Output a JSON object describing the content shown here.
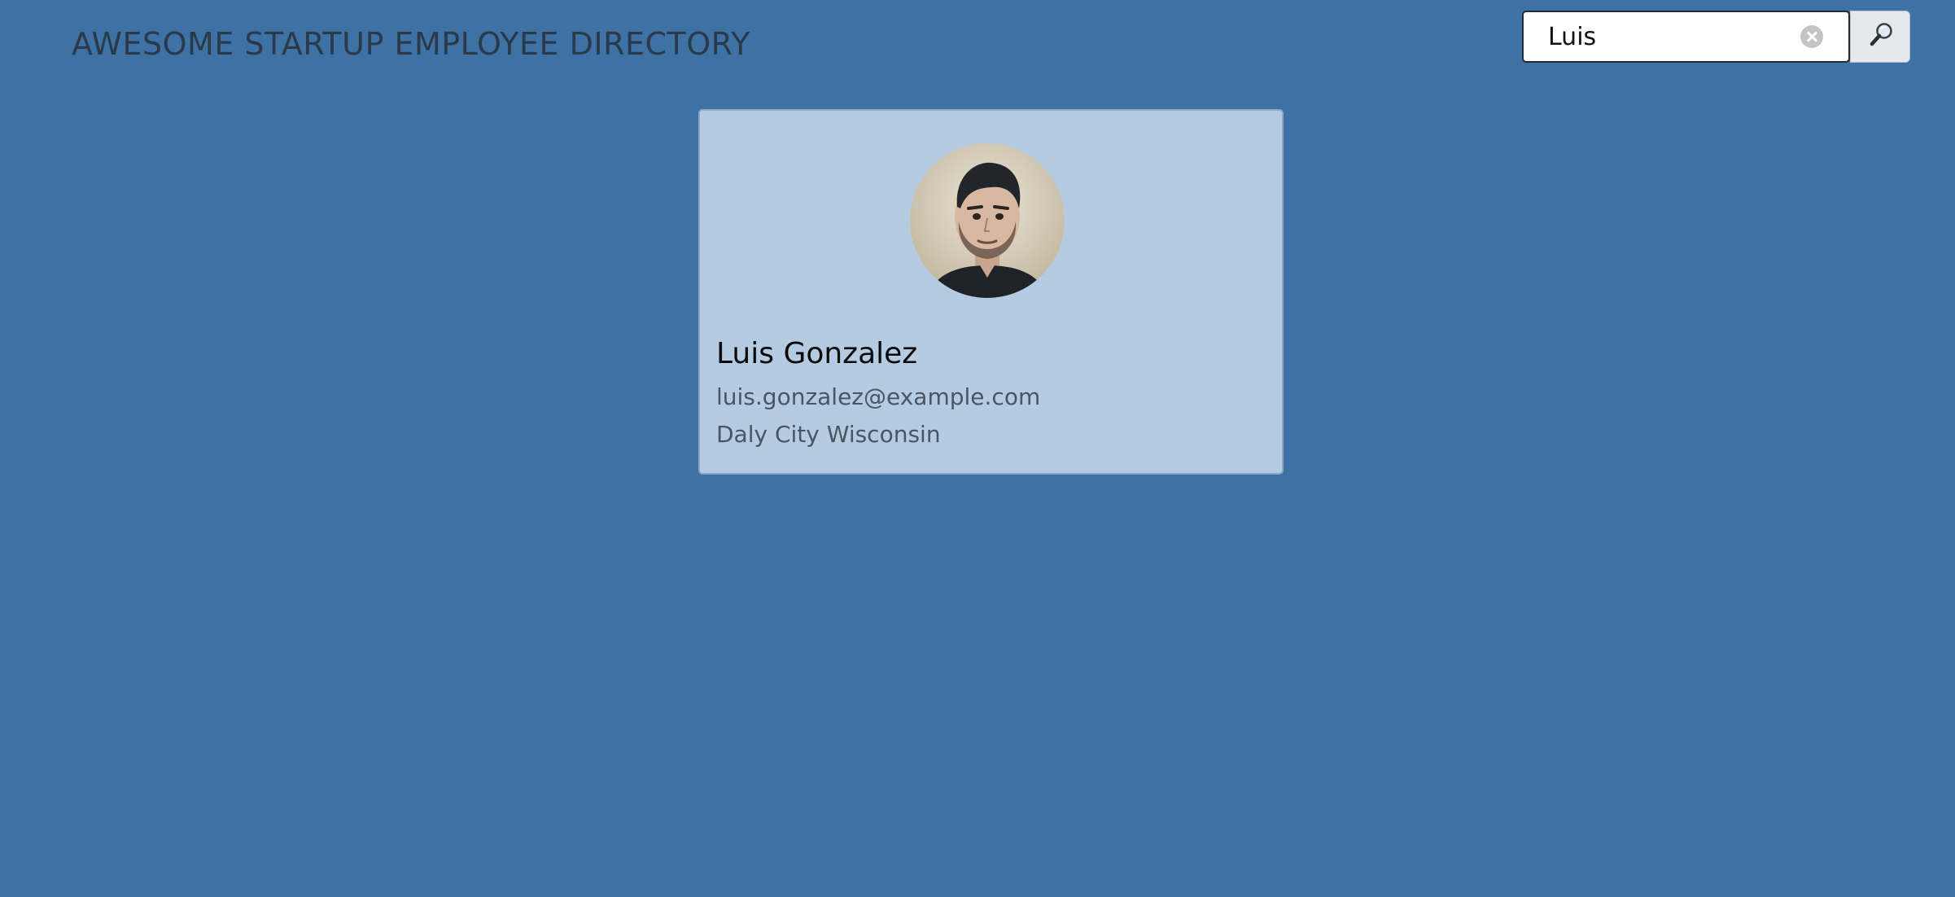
{
  "header": {
    "title": "AWESOME STARTUP EMPLOYEE DIRECTORY"
  },
  "search": {
    "value": "Luis",
    "clear_icon": "clear-circle-icon",
    "submit_icon": "magnifying-glass-icon"
  },
  "employees": [
    {
      "name": "Luis Gonzalez",
      "email": "luis.gonzalez@example.com",
      "location": "Daly City Wisconsin",
      "avatar_icon": "employee-photo"
    }
  ],
  "colors": {
    "background": "#3e72a4",
    "card_background": "#b5cbe2",
    "title_text": "#2b3a4a",
    "secondary_text": "#4a5563"
  }
}
